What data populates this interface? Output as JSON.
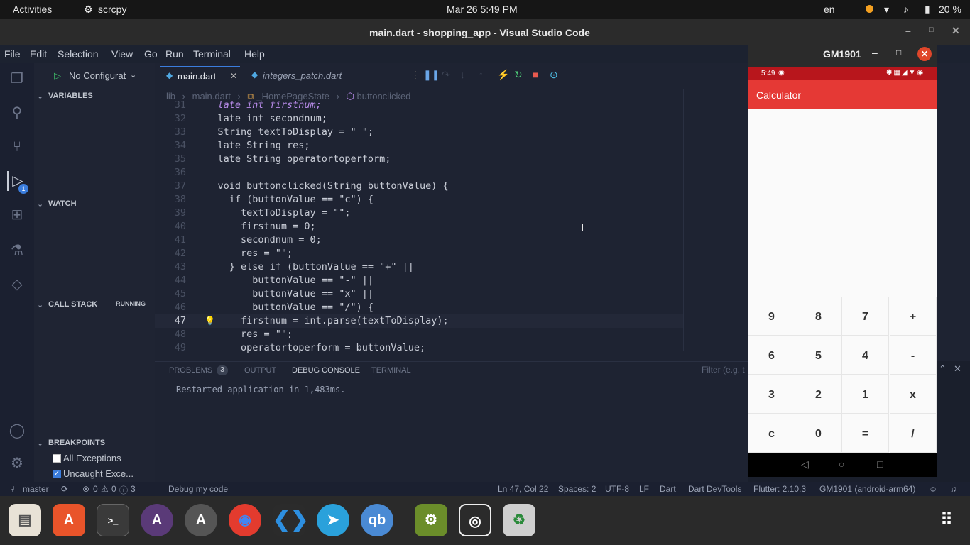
{
  "topbar": {
    "activities": "Activities",
    "app": "scrcpy",
    "datetime": "Mar 26  5:49 PM",
    "lang": "en",
    "battery": "20 %"
  },
  "titlebar": {
    "title": "main.dart - shopping_app - Visual Studio Code"
  },
  "menu": [
    "File",
    "Edit",
    "Selection",
    "View",
    "Go",
    "Run",
    "Terminal",
    "Help"
  ],
  "debug": {
    "config": "No Configurat"
  },
  "tabs": [
    {
      "label": "main.dart"
    },
    {
      "label": "integers_patch.dart"
    }
  ],
  "breadcrumbs": [
    "lib",
    "main.dart",
    "_HomePageState",
    "buttonclicked"
  ],
  "side": {
    "variables": "VARIABLES",
    "watch": "WATCH",
    "callstack": "CALL STACK",
    "running": "RUNNING",
    "breakpoints": "BREAKPOINTS",
    "bp1": "All Exceptions",
    "bp2": "Uncaught Exce...",
    "debug_badge": "1"
  },
  "code": [
    {
      "n": "31",
      "t": "    late int firstnum;"
    },
    {
      "n": "32",
      "t": "    late int secondnum;"
    },
    {
      "n": "33",
      "t": "    String textToDisplay = \" \";"
    },
    {
      "n": "34",
      "t": "    late String res;"
    },
    {
      "n": "35",
      "t": "    late String operatortoperform;"
    },
    {
      "n": "36",
      "t": ""
    },
    {
      "n": "37",
      "t": "    void buttonclicked(String buttonValue) {"
    },
    {
      "n": "38",
      "t": "      if (buttonValue == \"c\") {"
    },
    {
      "n": "39",
      "t": "        textToDisplay = \"\";"
    },
    {
      "n": "40",
      "t": "        firstnum = 0;"
    },
    {
      "n": "41",
      "t": "        secondnum = 0;"
    },
    {
      "n": "42",
      "t": "        res = \"\";"
    },
    {
      "n": "43",
      "t": "      } else if (buttonValue == \"+\" ||"
    },
    {
      "n": "44",
      "t": "          buttonValue == \"-\" ||"
    },
    {
      "n": "45",
      "t": "          buttonValue == \"x\" ||"
    },
    {
      "n": "46",
      "t": "          buttonValue == \"/\") {"
    },
    {
      "n": "47",
      "t": "        firstnum = int.parse(textToDisplay);"
    },
    {
      "n": "48",
      "t": "        res = \"\";"
    },
    {
      "n": "49",
      "t": "        operatortoperform = buttonValue;"
    }
  ],
  "panel": {
    "problems": "PROBLEMS",
    "problems_count": "3",
    "output": "OUTPUT",
    "debug_console": "DEBUG CONSOLE",
    "terminal": "TERMINAL",
    "filter": "Filter (e.g. t",
    "message": "Restarted application in 1,483ms."
  },
  "status": {
    "branch": "master",
    "errors": "0",
    "warnings": "0",
    "infos": "3",
    "debug": "Debug my code",
    "position": "Ln 47, Col 22",
    "spaces": "Spaces: 2",
    "encoding": "UTF-8",
    "eol": "LF",
    "language": "Dart",
    "devtools": "Dart DevTools",
    "flutter": "Flutter: 2.10.3",
    "device": "GM1901 (android-arm64)"
  },
  "phone": {
    "title": "GM1901",
    "time": "5:49",
    "appbar": "Calculator",
    "keys": [
      "9",
      "8",
      "7",
      "+",
      "6",
      "5",
      "4",
      "-",
      "3",
      "2",
      "1",
      "x",
      "c",
      "0",
      "=",
      "/"
    ]
  },
  "dock": [
    "Files",
    "Software",
    "Terminal",
    "App",
    "App",
    "Chrome",
    "VS Code",
    "Telegram",
    "qB",
    "Android",
    "Camera",
    "Trash"
  ]
}
